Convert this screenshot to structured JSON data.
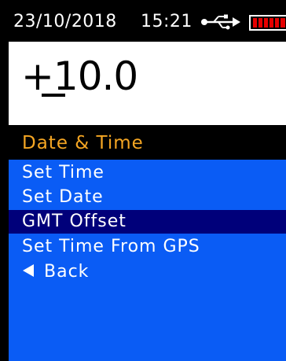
{
  "status_bar": {
    "date": "23/10/2018",
    "time": "15:21",
    "usb_icon": "usb-icon",
    "battery_icon": "battery-icon",
    "battery_color": "#e60000"
  },
  "value_display": {
    "value": "+10.0"
  },
  "menu": {
    "title": "Date & Time",
    "title_color": "#f5a623",
    "background_color": "#0a5cf5",
    "selected_color": "#00007a",
    "items": [
      {
        "label": "Set Time",
        "selected": false
      },
      {
        "label": "Set Date",
        "selected": false
      },
      {
        "label": "GMT Offset",
        "selected": true
      },
      {
        "label": "Set Time From GPS",
        "selected": false
      },
      {
        "label": "Back",
        "selected": false,
        "icon": "back-arrow-icon"
      }
    ]
  }
}
